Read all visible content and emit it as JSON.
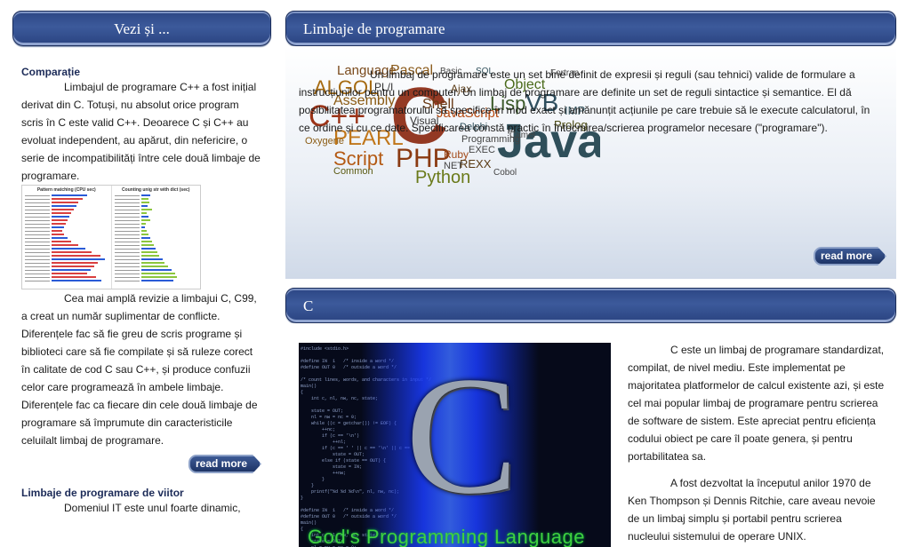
{
  "sidebar": {
    "title": "Vezi și ...",
    "section1": {
      "heading": "Comparație",
      "para1": "Limbajul de programare C++ a fost inițial derivat din C. Totuși, nu absolut orice program scris în C este valid C++. Deoarece C și C++ au evoluat independent, au apărut, din nefericire, o serie de incompatibilități între cele două limbaje de programare.",
      "image_left_title": "Pattern matching (CPU sec)",
      "image_right_title": "Counting unig str with dict (sec)",
      "para2": "Cea mai amplă revizie a limbajui C, C99, a creat un număr suplimentar de conflicte. Diferențele fac să fie greu de scris programe și biblioteci care să fie compilate și să ruleze corect în calitate de cod C sau C++, și produce confuzii celor care programează în ambele limbaje. Diferențele fac ca fiecare din cele două limbaje de programare să împrumute din caracteristicile celuilalt limbaj de programare.",
      "read_more": "read more"
    },
    "section2": {
      "heading": "Limbaje de programare de viitor",
      "para1": "Domeniul IT este unul foarte dinamic,"
    }
  },
  "main": {
    "article1": {
      "title": "Limbaje de programare",
      "text": "Un limbaj de programare este un set bine definit de expresii și reguli (sau tehnici) valide de formulare a instrucțiunilor pentru un computer. Un limbaj de programare are definite un set de reguli sintactice și semantice. El dă posibilitatea programatorului să specifice în mod exact și amănunțit acțiunile pe care trebuie să le execute calculatorul, în ce ordine și cu ce date. Specificarea constă practic în întocmirea/scrierea programelor necesare (\"programare\").",
      "read_more": "read more",
      "word_cloud": [
        "Language",
        "Pascal",
        "ALGOL",
        "PL/I",
        "C",
        "Lisp",
        "VB",
        "Java",
        "C++",
        "Assembly",
        "Shell",
        "JavaScript",
        "Object",
        "PEARL",
        "Script",
        "PHP",
        "Python",
        "Ruby",
        "REXX",
        "Prolog",
        "IMP",
        "Ajax",
        "Visual",
        "Delphi",
        "Oxygene",
        "Common",
        "Programming",
        "EXEC",
        "NET",
        "SQL",
        "Basic",
        "Camel",
        "Cobol",
        "Fortran"
      ]
    },
    "article2": {
      "title": "C",
      "image_caption": "God's Programming Language",
      "para1": "C este un limbaj de programare standardizat, compilat, de nivel mediu. Este implementat pe majoritatea platformelor de calcul existente azi, și este cel mai popular limbaj de programare pentru scrierea de software de sistem. Este apreciat pentru eficiența codului obiect pe care îl poate genera, și pentru portabilitatea sa.",
      "para2": "A fost dezvoltat la începutul anilor 1970 de Ken Thompson și Dennis Ritchie, care aveau nevoie de un limbaj simplu și portabil pentru scrierea nucleului sistemului de operare UNIX."
    }
  },
  "colors": {
    "header_blue": "#2c4684",
    "heading_navy": "#1c2b58",
    "caption_green": "#3fd13f"
  }
}
